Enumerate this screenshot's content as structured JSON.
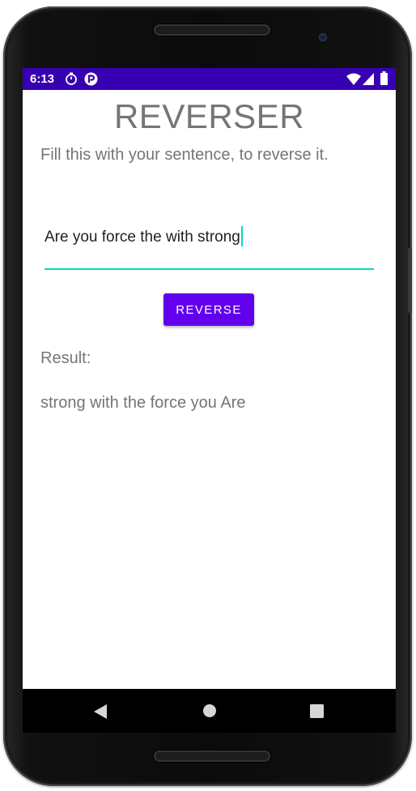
{
  "status_bar": {
    "time": "6:13",
    "icons": [
      "timer-icon",
      "app-notification-icon",
      "wifi-icon",
      "signal-icon",
      "battery-icon"
    ],
    "background": "#3700b3"
  },
  "app": {
    "title": "REVERSER",
    "subtitle": "Fill this with your sentence, to reverse it.",
    "input": {
      "value": "Are you force the with strong",
      "accent": "#03dac5"
    },
    "reverse_button": {
      "label": "REVERSE",
      "color": "#6200ee"
    },
    "result_label": "Result:",
    "result_value": "strong with the force you Are"
  },
  "nav_bar": {
    "icons": [
      "back-icon",
      "home-icon",
      "recents-icon"
    ]
  }
}
